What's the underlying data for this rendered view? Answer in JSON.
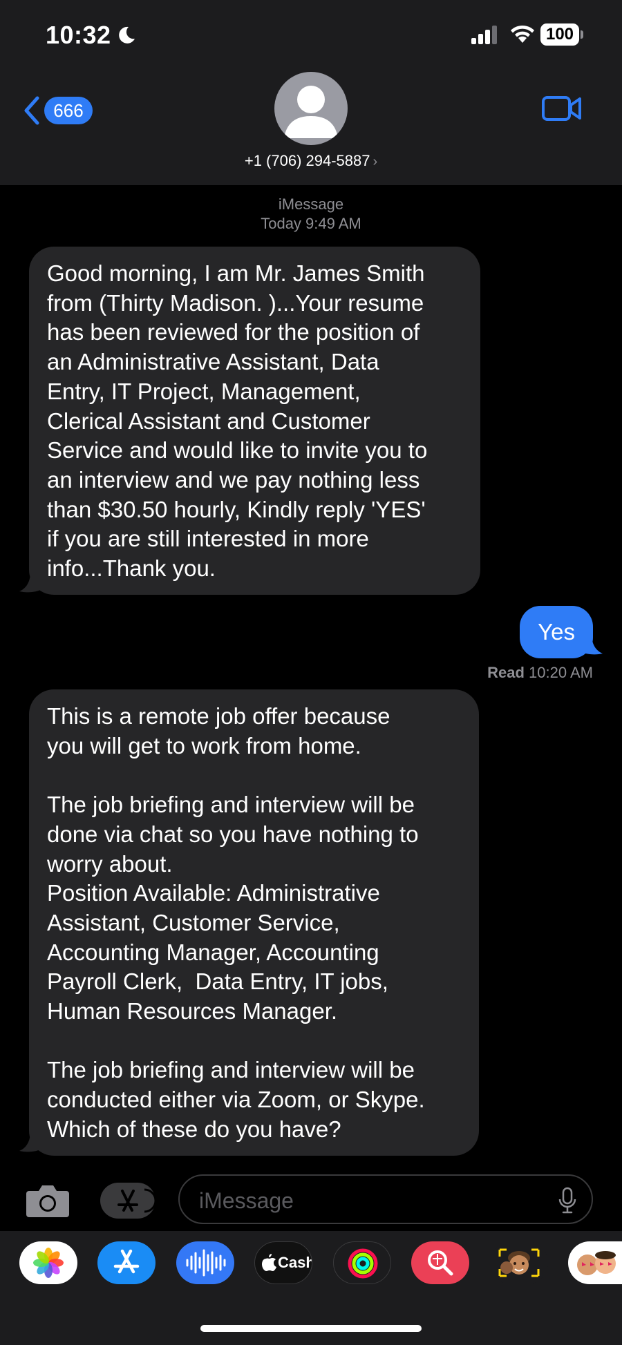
{
  "status_bar": {
    "time": "10:32",
    "battery": "100"
  },
  "header": {
    "back_badge": "666",
    "contact": "+1 (706) 294-5887",
    "chevron": "›"
  },
  "thread": {
    "service": "iMessage",
    "timestamp": "Today 9:49 AM",
    "messages": [
      {
        "direction": "incoming",
        "text": "Good morning, I am Mr. James Smith\nfrom (Thirty Madison. )...Your resume\nhas been reviewed for the position of\nan Administrative Assistant, Data\nEntry, IT Project, Management,\nClerical Assistant and Customer\nService and would like to invite you to\nan interview and we pay nothing less\nthan $30.50 hourly, Kindly reply 'YES'\nif you are still interested in more\ninfo...Thank you."
      },
      {
        "direction": "outgoing",
        "text": "Yes"
      },
      {
        "direction": "incoming",
        "text": "This is a remote job offer because\nyou will get to work from home.\n\nThe job briefing and interview will be\ndone via chat so you have nothing to\nworry about.\nPosition Available: Administrative\nAssistant, Customer Service,\nAccounting Manager, Accounting\nPayroll Clerk,  Data Entry, IT jobs,\nHuman Resources Manager.\n\nThe job briefing and interview will be\nconducted either via Zoom, or Skype.\nWhich of these do you have?"
      }
    ],
    "read_receipt": {
      "label": "Read",
      "time": "10:20 AM"
    }
  },
  "composer": {
    "placeholder": "iMessage"
  },
  "app_tray": {
    "apps": [
      {
        "icon": "photos-app-icon"
      },
      {
        "icon": "app-store-icon"
      },
      {
        "icon": "audio-message-icon"
      },
      {
        "icon": "apple-cash-icon",
        "label": "Cash"
      },
      {
        "icon": "fitness-icon"
      },
      {
        "icon": "image-search-icon"
      },
      {
        "icon": "memoji-icon"
      },
      {
        "icon": "memoji-stickers-icon"
      }
    ]
  },
  "colors": {
    "accent": "#2f7cf6",
    "incoming_bubble": "#262628",
    "header_bg": "#1c1c1e",
    "secondary_text": "#8e8e93"
  }
}
